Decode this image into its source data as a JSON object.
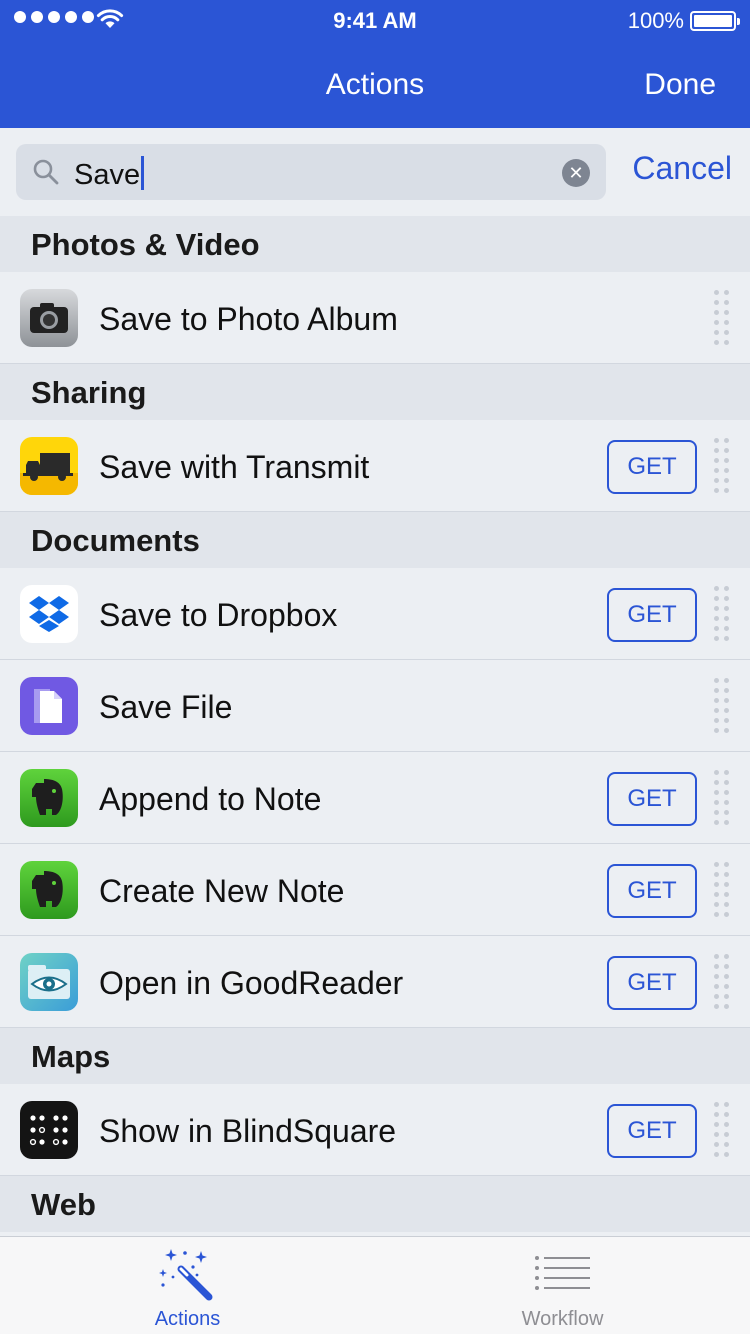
{
  "status": {
    "time": "9:41 AM",
    "battery": "100%"
  },
  "nav": {
    "title": "Actions",
    "done": "Done"
  },
  "search": {
    "query": "Save",
    "cancel": "Cancel"
  },
  "sections": [
    {
      "title": "Photos & Video",
      "items": [
        {
          "label": "Save to Photo Album",
          "icon": "camera-icon",
          "get": ""
        }
      ]
    },
    {
      "title": "Sharing",
      "items": [
        {
          "label": "Save with Transmit",
          "icon": "transmit-truck-icon",
          "get": "GET"
        }
      ]
    },
    {
      "title": "Documents",
      "items": [
        {
          "label": "Save to Dropbox",
          "icon": "dropbox-icon",
          "get": "GET"
        },
        {
          "label": "Save File",
          "icon": "file-icon",
          "get": ""
        },
        {
          "label": "Append to Note",
          "icon": "evernote-elephant-icon",
          "get": "GET"
        },
        {
          "label": "Create New Note",
          "icon": "evernote-elephant-icon",
          "get": "GET"
        },
        {
          "label": "Open in GoodReader",
          "icon": "goodreader-eye-icon",
          "get": "GET"
        }
      ]
    },
    {
      "title": "Maps",
      "items": [
        {
          "label": "Show in BlindSquare",
          "icon": "blindsquare-dots-icon",
          "get": "GET"
        }
      ]
    },
    {
      "title": "Web",
      "items": []
    }
  ],
  "tabs": [
    {
      "label": "Actions",
      "active": true,
      "icon": "magic-wand-icon"
    },
    {
      "label": "Workflow",
      "active": false,
      "icon": "list-icon"
    }
  ],
  "colors": {
    "accent": "#2B55D5",
    "header": "#2B55D5",
    "background": "#ECEFF3",
    "section": "#E1E5EB",
    "inactive": "#8E8E93"
  }
}
